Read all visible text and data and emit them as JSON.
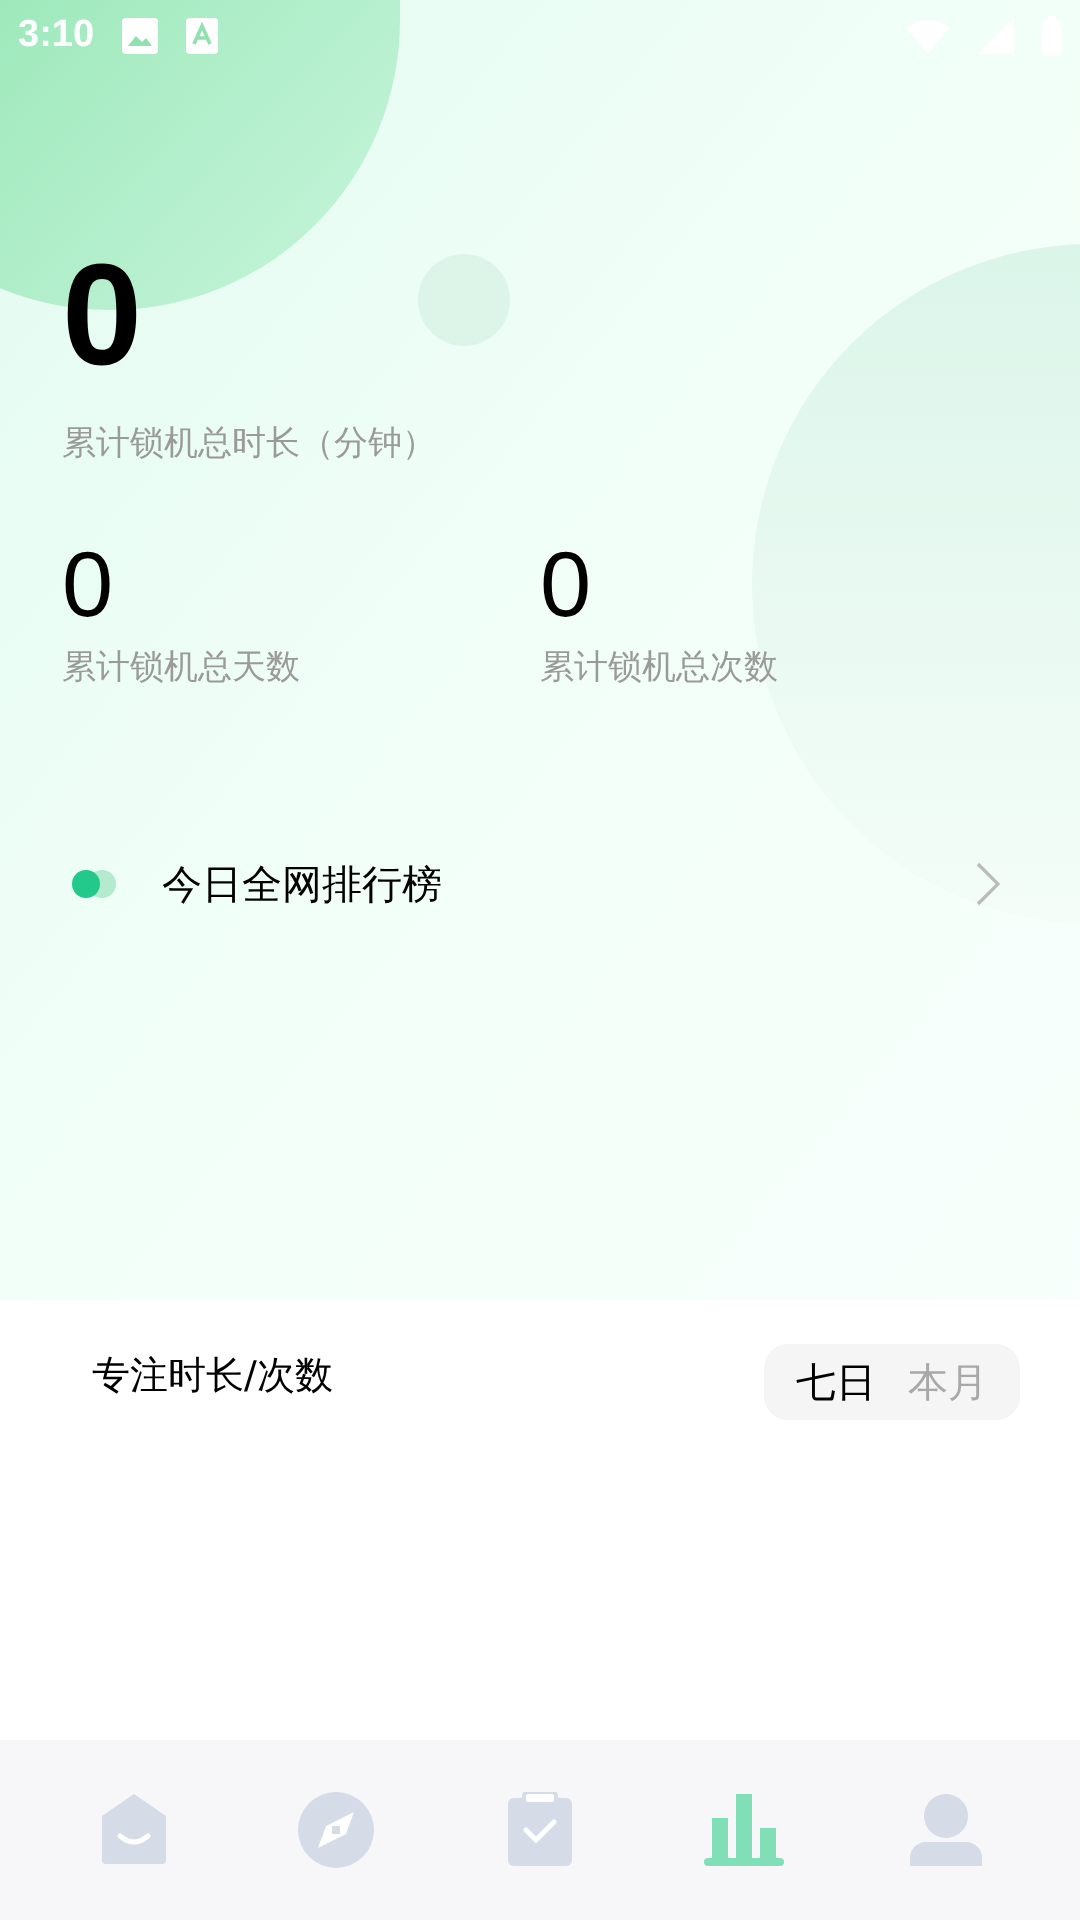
{
  "status_bar": {
    "time": "3:10"
  },
  "summary": {
    "total_value": "0",
    "total_label": "累计锁机总时长（分钟）",
    "stats": [
      {
        "value": "0",
        "label": "累计锁机总天数"
      },
      {
        "value": "0",
        "label": "累计锁机总次数"
      }
    ]
  },
  "ranking": {
    "label": "今日全网排行榜"
  },
  "focus": {
    "title": "专注时长/次数",
    "periods": [
      {
        "label": "七日",
        "selected": true
      },
      {
        "label": "本月",
        "selected": false
      }
    ]
  },
  "bottom_nav": [
    {
      "selected": false
    },
    {
      "selected": false
    },
    {
      "selected": false
    },
    {
      "selected": true
    },
    {
      "selected": false
    }
  ]
}
